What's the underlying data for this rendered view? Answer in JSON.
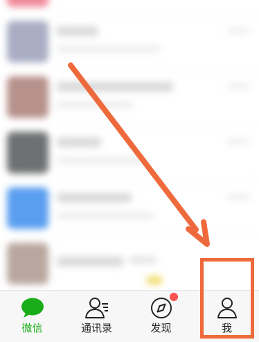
{
  "tabbar": {
    "tabs": [
      {
        "id": "chats",
        "label": "微信",
        "icon": "chat-bubble-icon",
        "active": true
      },
      {
        "id": "contacts",
        "label": "通讯录",
        "icon": "contacts-icon",
        "active": false
      },
      {
        "id": "discover",
        "label": "发现",
        "icon": "compass-icon",
        "active": false,
        "badge": true
      },
      {
        "id": "me",
        "label": "我",
        "icon": "person-icon",
        "active": false
      }
    ]
  },
  "colors": {
    "accent": "#1aad19",
    "annotation": "#ee6a3c",
    "badge": "#fa5151"
  }
}
